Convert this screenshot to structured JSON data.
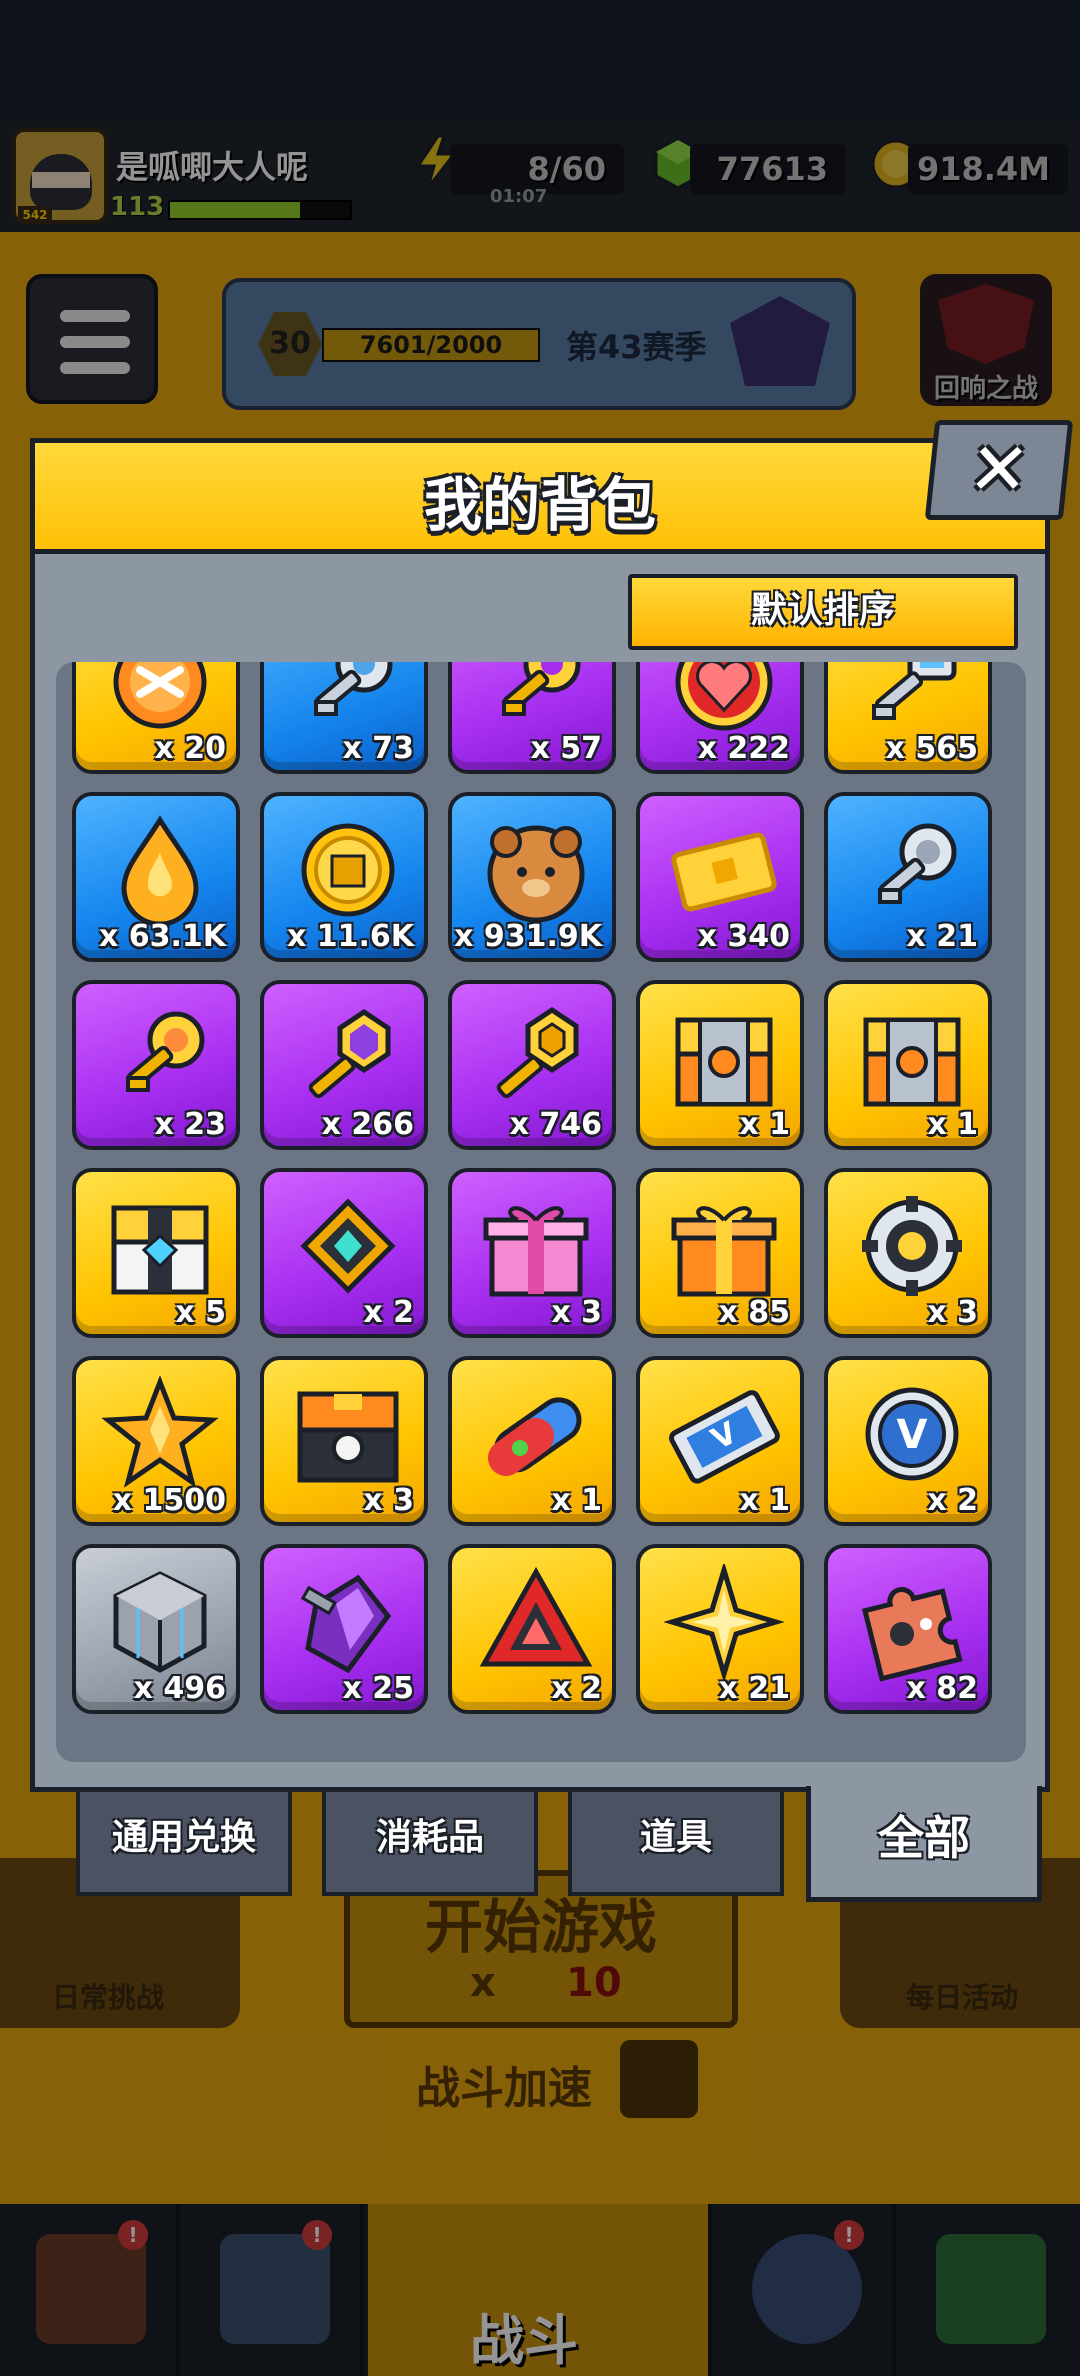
{
  "hud": {
    "player_name": "是呱唧大人呢",
    "avatar_badge": "542",
    "level": "113",
    "xp_fill": 0.72,
    "energy": "8/60",
    "energy_timer": "01:07",
    "gems": "77613",
    "coins": "918.4M"
  },
  "lobby": {
    "season_level": "30",
    "season_progress": "7601/2000",
    "season_name": "第43赛季",
    "echo_battle": "回响之战",
    "daily_challenge": "日常挑战",
    "daily_activity": "每日活动",
    "start_game": "开始游戏",
    "start_cost_prefix": "x",
    "start_cost": "10",
    "battle_speed": "战斗加速",
    "battle_tab": "战斗",
    "nav_badge": "!"
  },
  "backpack": {
    "title": "我的背包",
    "close_label": "✕",
    "sort_label": "默认排序",
    "items": [
      {
        "icon": "orange-rune-orb-icon",
        "rarity": "gold",
        "qty": "x 20"
      },
      {
        "icon": "silver-key-icon",
        "rarity": "blue",
        "qty": "x 73"
      },
      {
        "icon": "gold-key-icon",
        "rarity": "purple",
        "qty": "x 57"
      },
      {
        "icon": "heart-medal-icon",
        "rarity": "purple",
        "qty": "x 222"
      },
      {
        "icon": "crystal-key-icon",
        "rarity": "gold",
        "qty": "x 565"
      },
      {
        "icon": "flame-drop-icon",
        "rarity": "blue",
        "qty": "x 63.1K"
      },
      {
        "icon": "gold-coin-icon",
        "rarity": "blue",
        "qty": "x 11.6K"
      },
      {
        "icon": "dog-cookie-icon",
        "rarity": "blue",
        "qty": "x 931.9K"
      },
      {
        "icon": "gold-ticket-icon",
        "rarity": "purple",
        "qty": "x 340"
      },
      {
        "icon": "skull-key-icon",
        "rarity": "blue",
        "qty": "x 21"
      },
      {
        "icon": "rose-key-icon",
        "rarity": "purple",
        "qty": "x 23"
      },
      {
        "icon": "amethyst-key-icon",
        "rarity": "purple",
        "qty": "x 266"
      },
      {
        "icon": "hex-key-icon",
        "rarity": "purple",
        "qty": "x 746"
      },
      {
        "icon": "orange-chest-icon",
        "rarity": "gold",
        "qty": "x 1"
      },
      {
        "icon": "orange-chest-icon",
        "rarity": "gold",
        "qty": "x 1"
      },
      {
        "icon": "gem-chest-icon",
        "rarity": "gold",
        "qty": "x 5"
      },
      {
        "icon": "map-gem-icon",
        "rarity": "purple",
        "qty": "x 2"
      },
      {
        "icon": "pink-gift-icon",
        "rarity": "purple",
        "qty": "x 3"
      },
      {
        "icon": "orange-gift-icon",
        "rarity": "gold",
        "qty": "x 85"
      },
      {
        "icon": "gear-ring-icon",
        "rarity": "gold",
        "qty": "x 3"
      },
      {
        "icon": "star-crystal-icon",
        "rarity": "gold",
        "qty": "x 1500"
      },
      {
        "icon": "black-chest-icon",
        "rarity": "gold",
        "qty": "x 3"
      },
      {
        "icon": "capsule-icon",
        "rarity": "gold",
        "qty": "x 1"
      },
      {
        "icon": "v-ticket-icon",
        "rarity": "gold",
        "qty": "x 1"
      },
      {
        "icon": "v-coin-icon",
        "rarity": "gold",
        "qty": "x 2"
      },
      {
        "icon": "cube-icon",
        "rarity": "gray",
        "qty": "x 496"
      },
      {
        "icon": "purple-crystal-icon",
        "rarity": "purple",
        "qty": "x 25"
      },
      {
        "icon": "red-triangle-icon",
        "rarity": "gold",
        "qty": "x 2"
      },
      {
        "icon": "gold-star-icon",
        "rarity": "gold",
        "qty": "x 21"
      },
      {
        "icon": "puzzle-piece-icon",
        "rarity": "purple",
        "qty": "x 82"
      }
    ],
    "tabs": [
      {
        "label": "通用兑换",
        "active": false
      },
      {
        "label": "消耗品",
        "active": false
      },
      {
        "label": "道具",
        "active": false
      },
      {
        "label": "全部",
        "active": true
      }
    ]
  },
  "colors": {
    "accent_yellow": "#ffc107",
    "frame_dark": "#1b1f28",
    "panel_gray": "#8d96a3"
  }
}
